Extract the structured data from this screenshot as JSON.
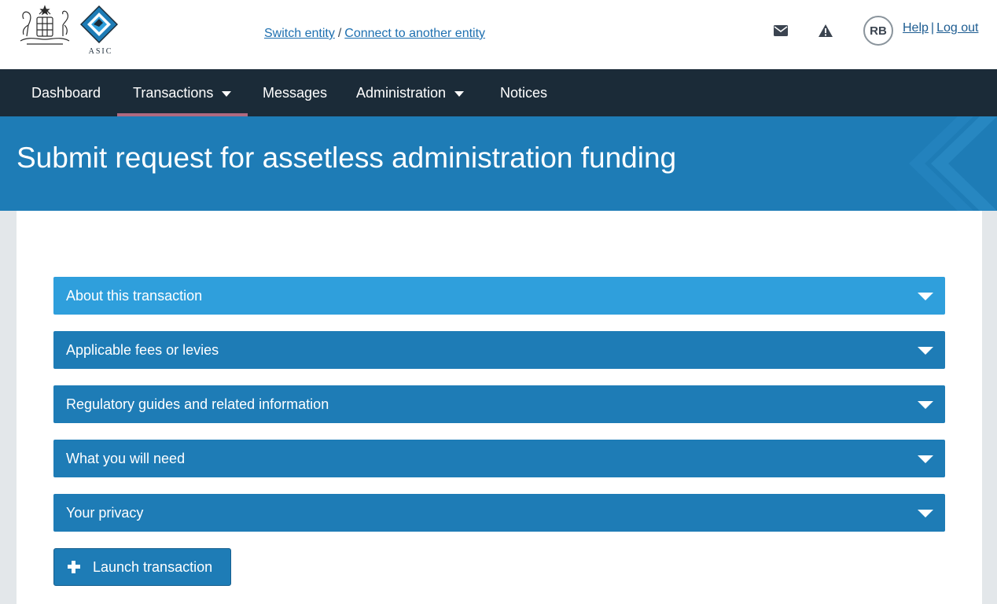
{
  "header": {
    "logo_text": "ASIC",
    "switch_entity": "Switch entity",
    "separator": "/",
    "connect_entity": "Connect to another entity",
    "avatar_initials": "RB",
    "help": "Help",
    "help_separator": "|",
    "logout": "Log out",
    "icons": [
      "envelope-icon",
      "warning-icon"
    ]
  },
  "nav": {
    "items": [
      {
        "label": "Dashboard"
      },
      {
        "label": "Transactions",
        "dropdown": true,
        "active": true
      },
      {
        "label": "Messages"
      },
      {
        "label": "Administration",
        "dropdown": true
      },
      {
        "label": "Notices"
      }
    ]
  },
  "page": {
    "title": "Submit request for assetless administration funding"
  },
  "accordions": [
    {
      "label": "About this transaction"
    },
    {
      "label": "Applicable fees or levies"
    },
    {
      "label": "Regulatory guides and related information"
    },
    {
      "label": "What you will need"
    },
    {
      "label": "Your privacy"
    }
  ],
  "actions": {
    "launch_label": "Launch transaction"
  },
  "colors": {
    "nav_bg": "#1b2b38",
    "banner_bg": "#1e7cb6",
    "accordion_bg": "#1e7cb6",
    "accordion_active_bg": "#2f9fdc",
    "link": "#1d6fb0"
  }
}
